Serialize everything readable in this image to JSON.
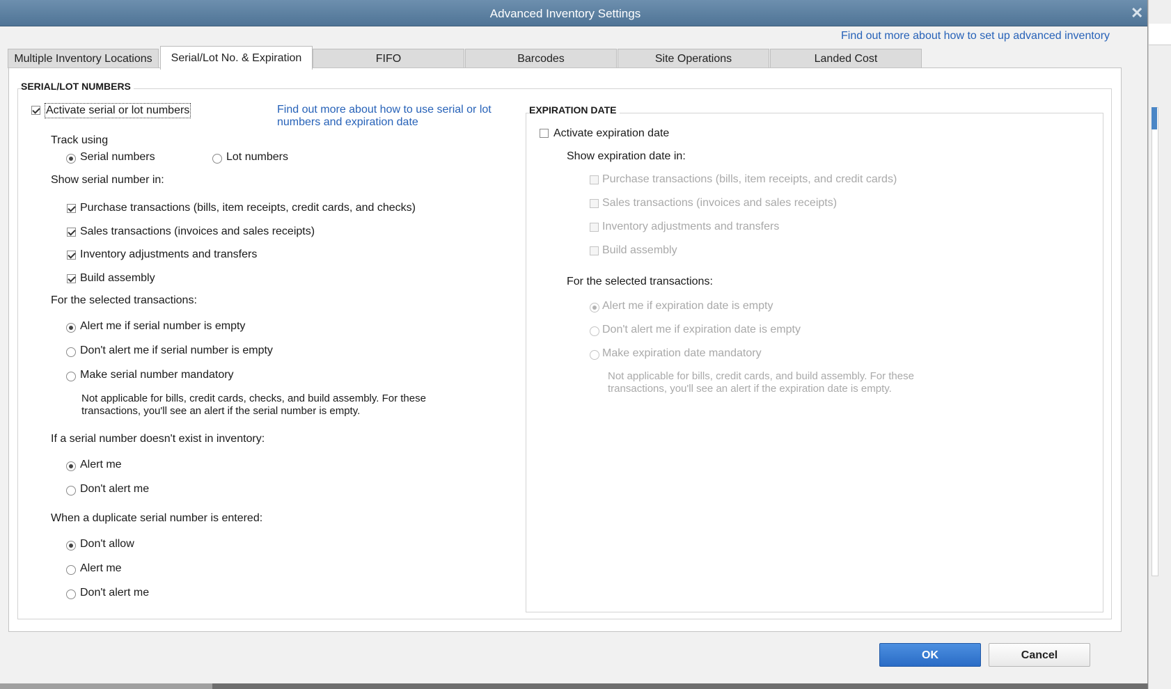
{
  "window": {
    "title": "Advanced Inventory Settings"
  },
  "top_link": "Find out more about how to set up advanced inventory",
  "tabs": [
    {
      "label": "Multiple Inventory Locations",
      "active": false
    },
    {
      "label": "Serial/Lot No. & Expiration",
      "active": true
    },
    {
      "label": "FIFO",
      "active": false
    },
    {
      "label": "Barcodes",
      "active": false
    },
    {
      "label": "Site Operations",
      "active": false
    },
    {
      "label": "Landed Cost",
      "active": false
    }
  ],
  "serial": {
    "section_title": "SERIAL/LOT NUMBERS",
    "activate_label": "Activate serial or lot numbers",
    "activate_checked": true,
    "help_link_line1": "Find out more about how to use serial or lot",
    "help_link_line2": "numbers and expiration date",
    "track_using_label": "Track using",
    "track_options": [
      {
        "label": "Serial numbers",
        "checked": true
      },
      {
        "label": "Lot numbers",
        "checked": false
      }
    ],
    "show_in_label": "Show serial number in:",
    "show_in_items": [
      {
        "label": "Purchase transactions (bills, item receipts, credit cards, and checks)",
        "checked": true
      },
      {
        "label": "Sales transactions (invoices and sales receipts)",
        "checked": true
      },
      {
        "label": "Inventory adjustments and transfers",
        "checked": true
      },
      {
        "label": "Build assembly",
        "checked": true
      }
    ],
    "for_selected_label": "For the selected transactions:",
    "for_selected_options": [
      {
        "label": "Alert me if serial number is empty",
        "checked": true
      },
      {
        "label": "Don't alert me if serial number is empty",
        "checked": false
      },
      {
        "label": "Make serial number mandatory",
        "checked": false
      }
    ],
    "note_line1": "Not applicable for bills, credit cards, checks, and build assembly. For these",
    "note_line2": "transactions, you'll see an alert if the serial number is empty.",
    "not_exist_label": "If a serial number doesn't exist in inventory:",
    "not_exist_options": [
      {
        "label": "Alert me",
        "checked": true
      },
      {
        "label": "Don't alert me",
        "checked": false
      }
    ],
    "duplicate_label": "When a duplicate serial number is entered:",
    "duplicate_options": [
      {
        "label": "Don't allow",
        "checked": true
      },
      {
        "label": "Alert me",
        "checked": false
      },
      {
        "label": "Don't alert me",
        "checked": false
      }
    ]
  },
  "expiration": {
    "section_title": "EXPIRATION DATE",
    "activate_label": "Activate expiration date",
    "activate_checked": false,
    "show_in_label": "Show expiration date in:",
    "show_in_items": [
      {
        "label": "Purchase transactions (bills, item receipts, and credit cards)",
        "checked": false
      },
      {
        "label": "Sales transactions (invoices and sales receipts)",
        "checked": false
      },
      {
        "label": "Inventory adjustments and transfers",
        "checked": false
      },
      {
        "label": "Build assembly",
        "checked": false
      }
    ],
    "for_selected_label": "For the selected transactions:",
    "for_selected_options": [
      {
        "label": "Alert me if expiration date is empty",
        "checked": true
      },
      {
        "label": "Don't alert me if expiration date is empty",
        "checked": false
      },
      {
        "label": "Make expiration date mandatory",
        "checked": false
      }
    ],
    "note_line1": "Not applicable for bills, credit cards, and build assembly. For these",
    "note_line2": "transactions, you'll see an alert if the expiration date is empty."
  },
  "buttons": {
    "ok": "OK",
    "cancel": "Cancel"
  },
  "colors": {
    "title_bar": "#5b7fa2",
    "link": "#2762b8",
    "ok_button": "#2f73cf",
    "disabled_text": "#a9a9a9"
  }
}
